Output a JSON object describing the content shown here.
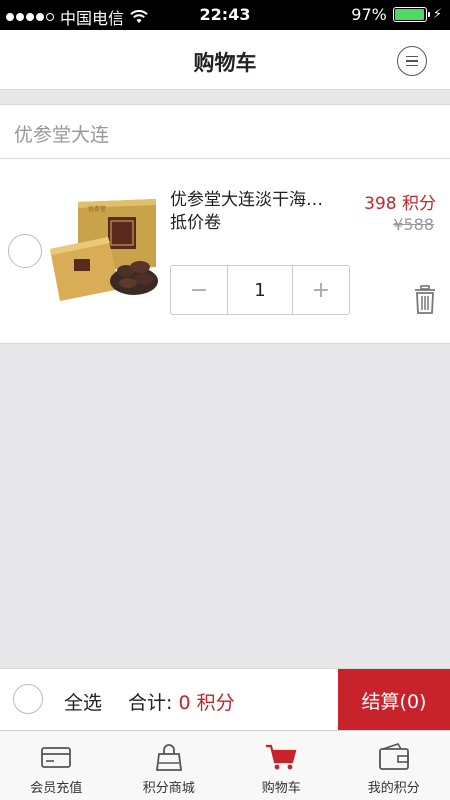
{
  "status_bar": {
    "carrier": "中国电信",
    "time": "22:43",
    "battery": "97%",
    "battery_level": 0.97
  },
  "nav": {
    "title": "购物车",
    "menu_icon": "menu-circle-icon"
  },
  "shop": {
    "name": "优参堂大连"
  },
  "cart_item": {
    "title_line1": "优参堂大连淡干海…",
    "title_line2": "抵价卷",
    "price": "398 积分",
    "original_price": "¥588",
    "quantity": "1",
    "minus_label": "−",
    "plus_label": "+"
  },
  "bottom_bar": {
    "select_all": "全选",
    "total_label": "合计: ",
    "total_value": "0 积分",
    "checkout": "结算(0)"
  },
  "tabs": [
    {
      "label": "会员充值",
      "icon": "card-icon"
    },
    {
      "label": "积分商城",
      "icon": "bag-icon"
    },
    {
      "label": "购物车",
      "icon": "cart-icon"
    },
    {
      "label": "我的积分",
      "icon": "wallet-icon"
    }
  ],
  "colors": {
    "accent": "#c8232a",
    "background": "#e8e8ea",
    "battery": "#4cd964"
  }
}
